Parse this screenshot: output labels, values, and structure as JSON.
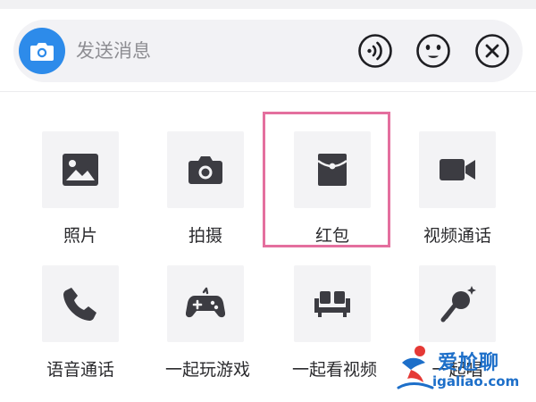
{
  "input": {
    "placeholder": "发送消息",
    "camera_icon": "camera-icon",
    "voice_icon": "voice-message-icon",
    "emoji_icon": "emoji-icon",
    "close_icon": "close-icon"
  },
  "tiles": [
    {
      "label": "照片",
      "icon": "image-icon"
    },
    {
      "label": "拍摄",
      "icon": "camera-icon"
    },
    {
      "label": "红包",
      "icon": "red-packet-icon"
    },
    {
      "label": "视频通话",
      "icon": "video-camera-icon"
    },
    {
      "label": "语音通话",
      "icon": "phone-icon"
    },
    {
      "label": "一起玩游戏",
      "icon": "gamepad-icon"
    },
    {
      "label": "一起看视频",
      "icon": "sofa-icon"
    },
    {
      "label": "一起唱",
      "icon": "microphone-icon"
    }
  ],
  "highlight": {
    "target": "红包",
    "color": "#e46f9e"
  },
  "watermark": {
    "cn": "爱尬聊",
    "url": "igaliao.com"
  },
  "colors": {
    "accent": "#2d8bea",
    "icon": "#3c3c42",
    "tile_bg": "#f3f3f5"
  }
}
